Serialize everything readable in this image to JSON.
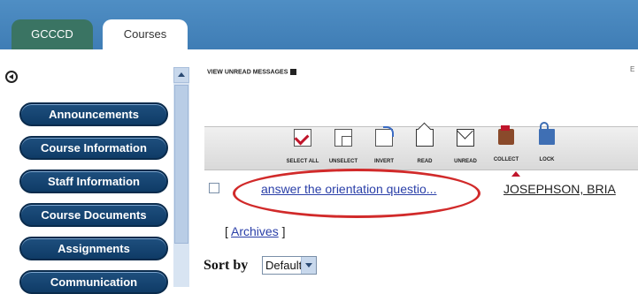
{
  "tabs": [
    {
      "label": "GCCCD"
    },
    {
      "label": "Courses"
    }
  ],
  "sidebar": {
    "items": [
      {
        "label": "Announcements"
      },
      {
        "label": "Course Information"
      },
      {
        "label": "Staff Information"
      },
      {
        "label": "Course Documents"
      },
      {
        "label": "Assignments"
      },
      {
        "label": "Communication"
      }
    ]
  },
  "content": {
    "view_unread": "VIEW UNREAD MESSAGES",
    "corner_mark": "E",
    "toolbar": [
      {
        "label": "SELECT ALL",
        "icon": "select-all-icon"
      },
      {
        "label": "UNSELECT",
        "icon": "unselect-icon"
      },
      {
        "label": "INVERT",
        "icon": "invert-icon"
      },
      {
        "label": "READ",
        "icon": "read-envelope-icon"
      },
      {
        "label": "UNREAD",
        "icon": "unread-envelope-icon"
      },
      {
        "label": "COLLECT",
        "icon": "collect-icon"
      },
      {
        "label": "LOCK",
        "icon": "lock-icon"
      }
    ],
    "message": {
      "subject": "answer the orientation questio...",
      "author": "JOSEPHSON, BRIA"
    },
    "archives_link": "Archives",
    "sort_label": "Sort by",
    "sort_value": "Default"
  },
  "colors": {
    "nav_button": "#0f3b66",
    "tab_active": "#3a7463",
    "annotation": "#d12a2a",
    "link": "#2a3fa8"
  }
}
